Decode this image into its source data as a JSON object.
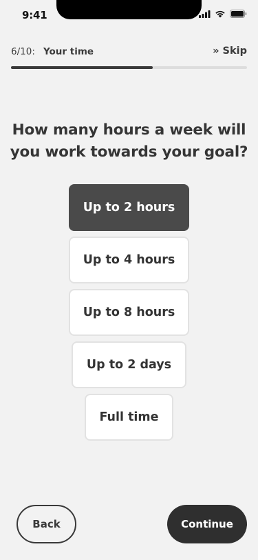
{
  "status_bar": {
    "time": "9:41",
    "icons": [
      "cellular-signal-icon",
      "wifi-icon",
      "battery-icon"
    ]
  },
  "header": {
    "step": "6/10:",
    "title": "Your time",
    "skip_label": "» Skip",
    "progress_fraction": 0.6
  },
  "question": "How many hours a week will you work towards your goal?",
  "options": [
    {
      "label": "Up to 2 hours",
      "selected": true
    },
    {
      "label": "Up to 4 hours",
      "selected": false
    },
    {
      "label": "Up to 8 hours",
      "selected": false
    },
    {
      "label": "Up to 2 days",
      "selected": false
    },
    {
      "label": "Full time",
      "selected": false
    }
  ],
  "footer": {
    "back_label": "Back",
    "continue_label": "Continue"
  },
  "colors": {
    "background": "#f2f2f2",
    "selected_option": "#4a4a4a",
    "primary_button": "#2f2f2f",
    "progress_fill": "#3a3a3a",
    "progress_track": "#dddddd"
  }
}
